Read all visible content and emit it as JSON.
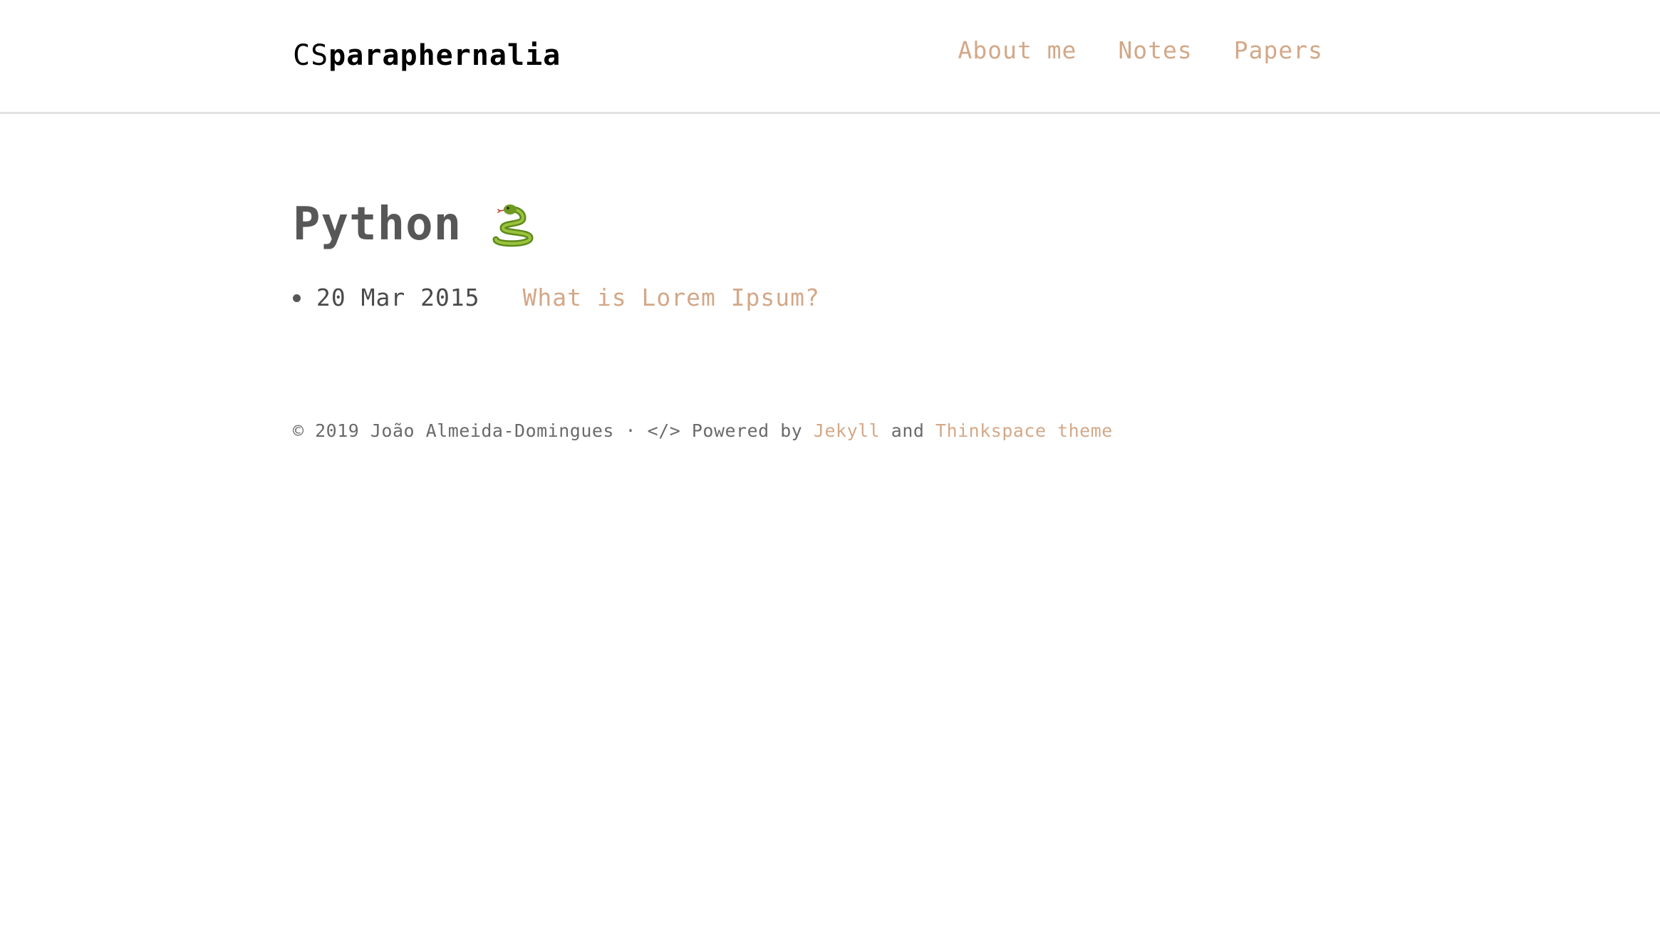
{
  "header": {
    "site_title_prefix": "CS",
    "site_title_suffix": "paraphernalia",
    "nav": [
      {
        "label": "About me"
      },
      {
        "label": "Notes"
      },
      {
        "label": "Papers"
      }
    ]
  },
  "main": {
    "title": "Python",
    "title_icon": "snake-icon",
    "posts": [
      {
        "date": "20 Mar 2015",
        "title": "What is Lorem Ipsum?"
      }
    ]
  },
  "footer": {
    "copyright": "© 2019 João Almeida-Domingues · </> Powered by",
    "jekyll_label": "Jekyll",
    "and_text": "and",
    "theme_label": "Thinkspace theme"
  },
  "colors": {
    "accent": "#d3a888",
    "text": "#575757",
    "divider": "#e2e2e2"
  }
}
